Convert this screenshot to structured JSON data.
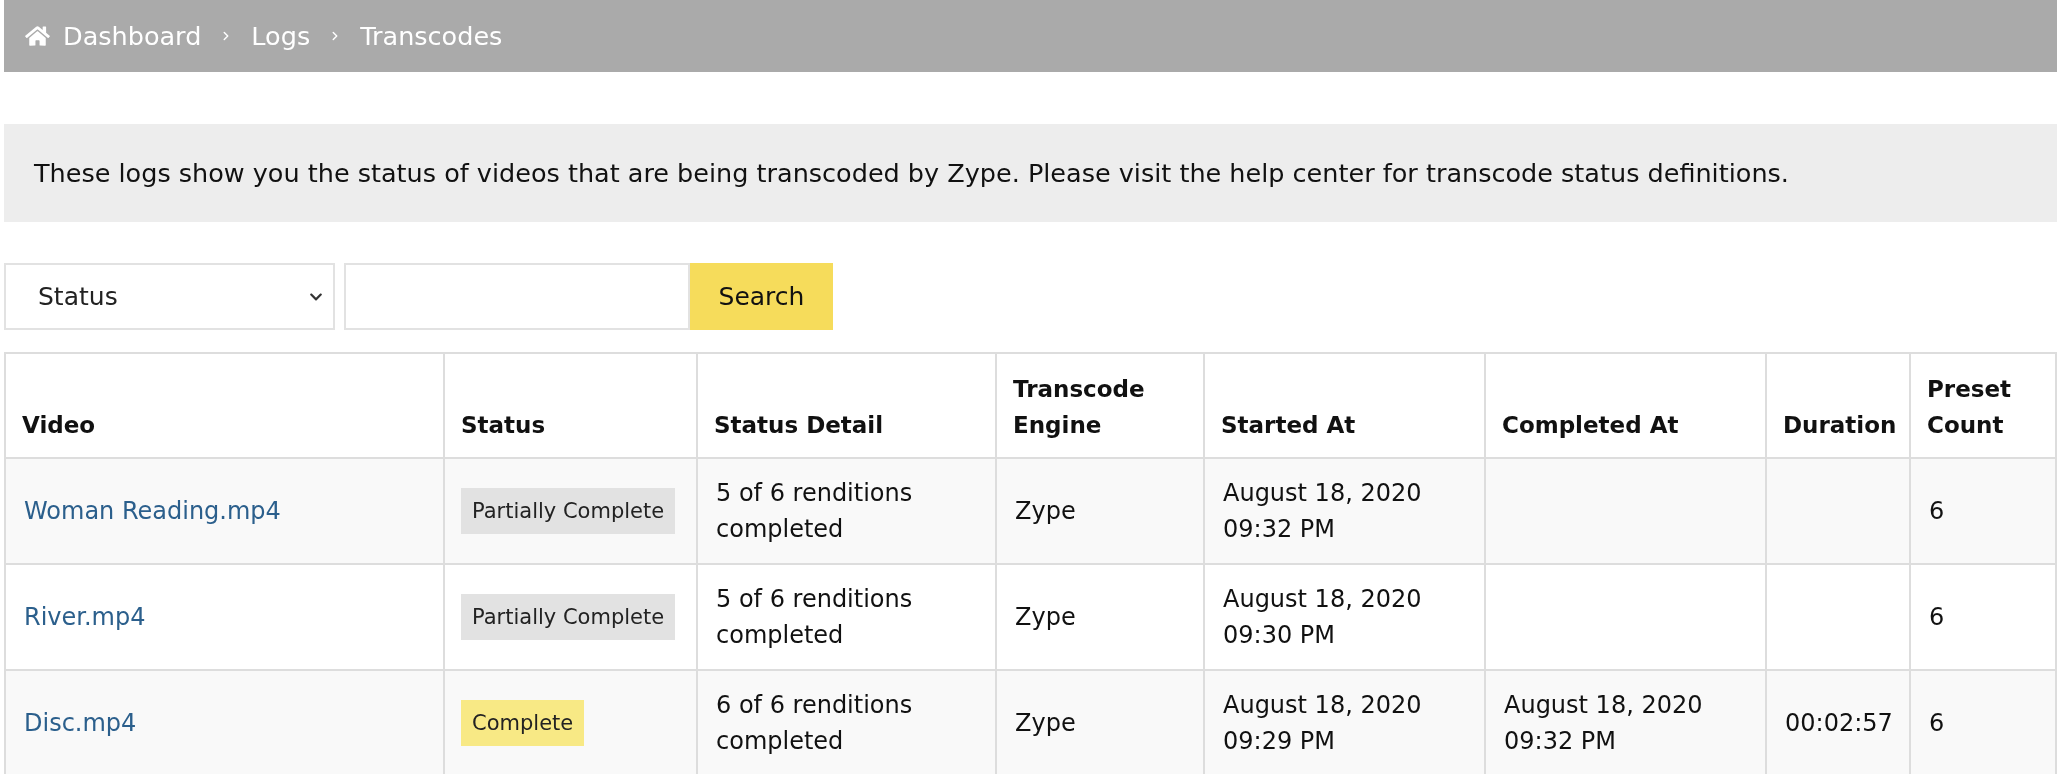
{
  "breadcrumb": [
    "Dashboard",
    "Logs",
    "Transcodes"
  ],
  "info": "These logs show you the status of videos that are being transcoded by Zype. Please visit the help center for transcode status definitions.",
  "filter": {
    "select": "Status",
    "search_button": "Search"
  },
  "table": {
    "columns": [
      "Video",
      "Status",
      "Status Detail",
      "Transcode Engine",
      "Started At",
      "Completed At",
      "Duration",
      "Preset Count"
    ],
    "rows": [
      {
        "video": "Woman Reading.mp4",
        "status": {
          "label": "Partially Complete",
          "kind": "partial"
        },
        "status_detail": "5 of 6 renditions completed",
        "transcode_engine": "Zype",
        "started_at": "August 18, 2020 09:32 PM",
        "preset_count": "6"
      },
      {
        "video": "River.mp4",
        "status": {
          "label": "Partially Complete",
          "kind": "partial"
        },
        "status_detail": "5 of 6 renditions completed",
        "transcode_engine": "Zype",
        "started_at": "August 18, 2020 09:30 PM",
        "preset_count": "6"
      },
      {
        "video": "Disc.mp4",
        "status": {
          "label": "Complete",
          "kind": "complete"
        },
        "status_detail": "6 of 6 renditions completed",
        "transcode_engine": "Zype",
        "started_at": "August 18, 2020 09:29 PM",
        "completed_at": "August 18, 2020 09:32 PM",
        "duration": "00:02:57",
        "preset_count": "6"
      }
    ]
  }
}
